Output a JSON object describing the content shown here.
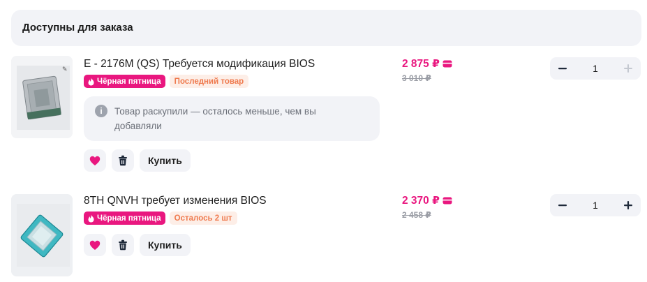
{
  "section": {
    "title": "Доступны для заказа"
  },
  "items": [
    {
      "checked": true,
      "title": "E - 2176M (QS) Требуется модификация BIOS",
      "badge_black_friday": "Чёрная пятница",
      "badge_stock": "Последний товар",
      "price": "2 875 ₽",
      "old_price": "3 010 ₽",
      "notice": "Товар раскупили — осталось меньше, чем вы добавляли",
      "buy_label": "Купить",
      "quantity": "1",
      "plus_enabled": false
    },
    {
      "checked": false,
      "title": "8TH QNVH требует изменения BIOS",
      "badge_black_friday": "Чёрная пятница",
      "badge_stock": "Осталось 2 шт",
      "price": "2 370 ₽",
      "old_price": "2 458 ₽",
      "buy_label": "Купить",
      "quantity": "1",
      "plus_enabled": true
    }
  ],
  "colors": {
    "accent_pink": "#e9177f",
    "checkbox_blue": "#1f63e8",
    "stock_orange": "#ef7b4f",
    "surface": "#f2f3f7"
  },
  "icons": [
    "check-icon",
    "fire-icon",
    "card-icon",
    "info-icon",
    "heart-icon",
    "trash-icon",
    "minus-icon",
    "plus-icon"
  ]
}
